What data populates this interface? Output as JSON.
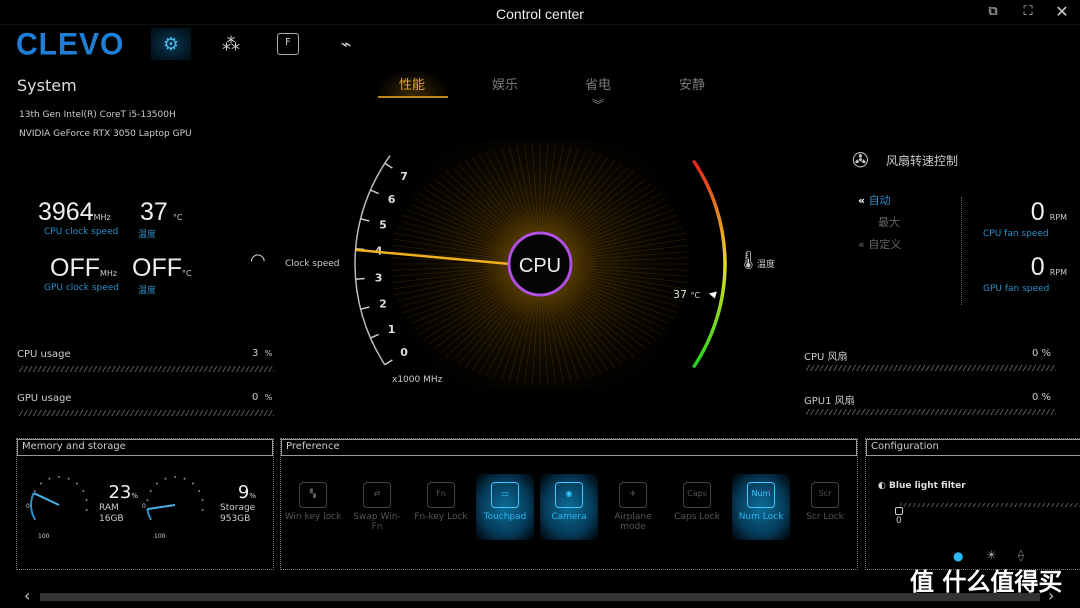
{
  "window": {
    "title": "Control center",
    "buttons": [
      "restore",
      "fullscreen",
      "close"
    ]
  },
  "brand": {
    "logo": "CLEVO",
    "accent": "#1f7ed6"
  },
  "nav": {
    "items": [
      {
        "icon": "system-gear-icon",
        "active": true
      },
      {
        "icon": "backlight-icon"
      },
      {
        "icon": "fn-key-icon"
      },
      {
        "icon": "usb-mouse-icon"
      }
    ]
  },
  "system": {
    "heading": "System",
    "cpu": "13th Gen Intel(R) CoreT i5-13500H",
    "gpu": "NVIDIA GeForce RTX 3050 Laptop GPU"
  },
  "stats": {
    "cpu_clock": "3964",
    "cpu_clock_unit": "MHz",
    "cpu_clock_label": "CPU clock speed",
    "cpu_temp": "37",
    "cpu_temp_unit": "°C",
    "cpu_temp_label": "温度",
    "gpu_clock": "OFF",
    "gpu_clock_unit": "MHz",
    "gpu_clock_label": "GPU clock speed",
    "gpu_temp": "OFF",
    "gpu_temp_unit": "°C",
    "gpu_temp_label": "温度"
  },
  "modes": [
    {
      "label": "性能",
      "active": true
    },
    {
      "label": "娱乐"
    },
    {
      "label": "省电"
    },
    {
      "label": "安静"
    }
  ],
  "gauge": {
    "center_label": "CPU",
    "clock_label": "Clock speed",
    "ticks": [
      "0",
      "1",
      "2",
      "3",
      "4",
      "5",
      "6",
      "7"
    ],
    "unit": "x1000 MHz",
    "value_mhz": 3964,
    "temp_label": "温度",
    "temp_value": "37",
    "temp_unit": "°C",
    "temp_min": 0,
    "temp_max": 100
  },
  "usage": {
    "cpu_label": "CPU usage",
    "cpu_value": "3",
    "gpu_label": "GPU usage",
    "gpu_value": "0",
    "unit": "%"
  },
  "fan": {
    "title": "风扇转速控制",
    "options": [
      {
        "label": "自动",
        "active": true
      },
      {
        "label": "最大"
      },
      {
        "label": "自定义"
      }
    ],
    "cpu_rpm": "0",
    "gpu_rpm": "0",
    "rpm_unit": "RPM",
    "cpu_rpm_label": "CPU fan speed",
    "gpu_rpm_label": "GPU fan speed",
    "cpu_fan_label": "CPU 风扇",
    "cpu_fan_value": "0 %",
    "gpu_fan_label": "GPU1 风扇",
    "gpu_fan_value": "0 %"
  },
  "memory": {
    "title": "Memory and storage",
    "ram_pct": "23",
    "ram_label": "RAM",
    "ram_size": "16GB",
    "storage_pct": "9",
    "storage_label": "Storage",
    "storage_size": "953GB",
    "dial_min": "0",
    "dial_max": "100",
    "pct_unit": "%"
  },
  "preference": {
    "title": "Preference",
    "items": [
      {
        "label": "Win key lock",
        "key": "",
        "on": false
      },
      {
        "label": "Swap Win-Fn",
        "key": "",
        "on": false
      },
      {
        "label": "Fn-key Lock",
        "key": "Fn",
        "on": false
      },
      {
        "label": "Touchpad",
        "key": "",
        "on": true
      },
      {
        "label": "Camera",
        "key": "",
        "on": true
      },
      {
        "label": "Airplane mode",
        "key": "",
        "on": false
      },
      {
        "label": "Caps Lock",
        "key": "Caps",
        "on": false
      },
      {
        "label": "Num Lock",
        "key": "Num",
        "on": true
      },
      {
        "label": "Scr Lock",
        "key": "Scr",
        "on": false
      }
    ]
  },
  "configuration": {
    "title": "Configuration",
    "blue_light_label": "Blue light filter",
    "blue_light_value": "0"
  },
  "watermark": "值 什么值得买"
}
